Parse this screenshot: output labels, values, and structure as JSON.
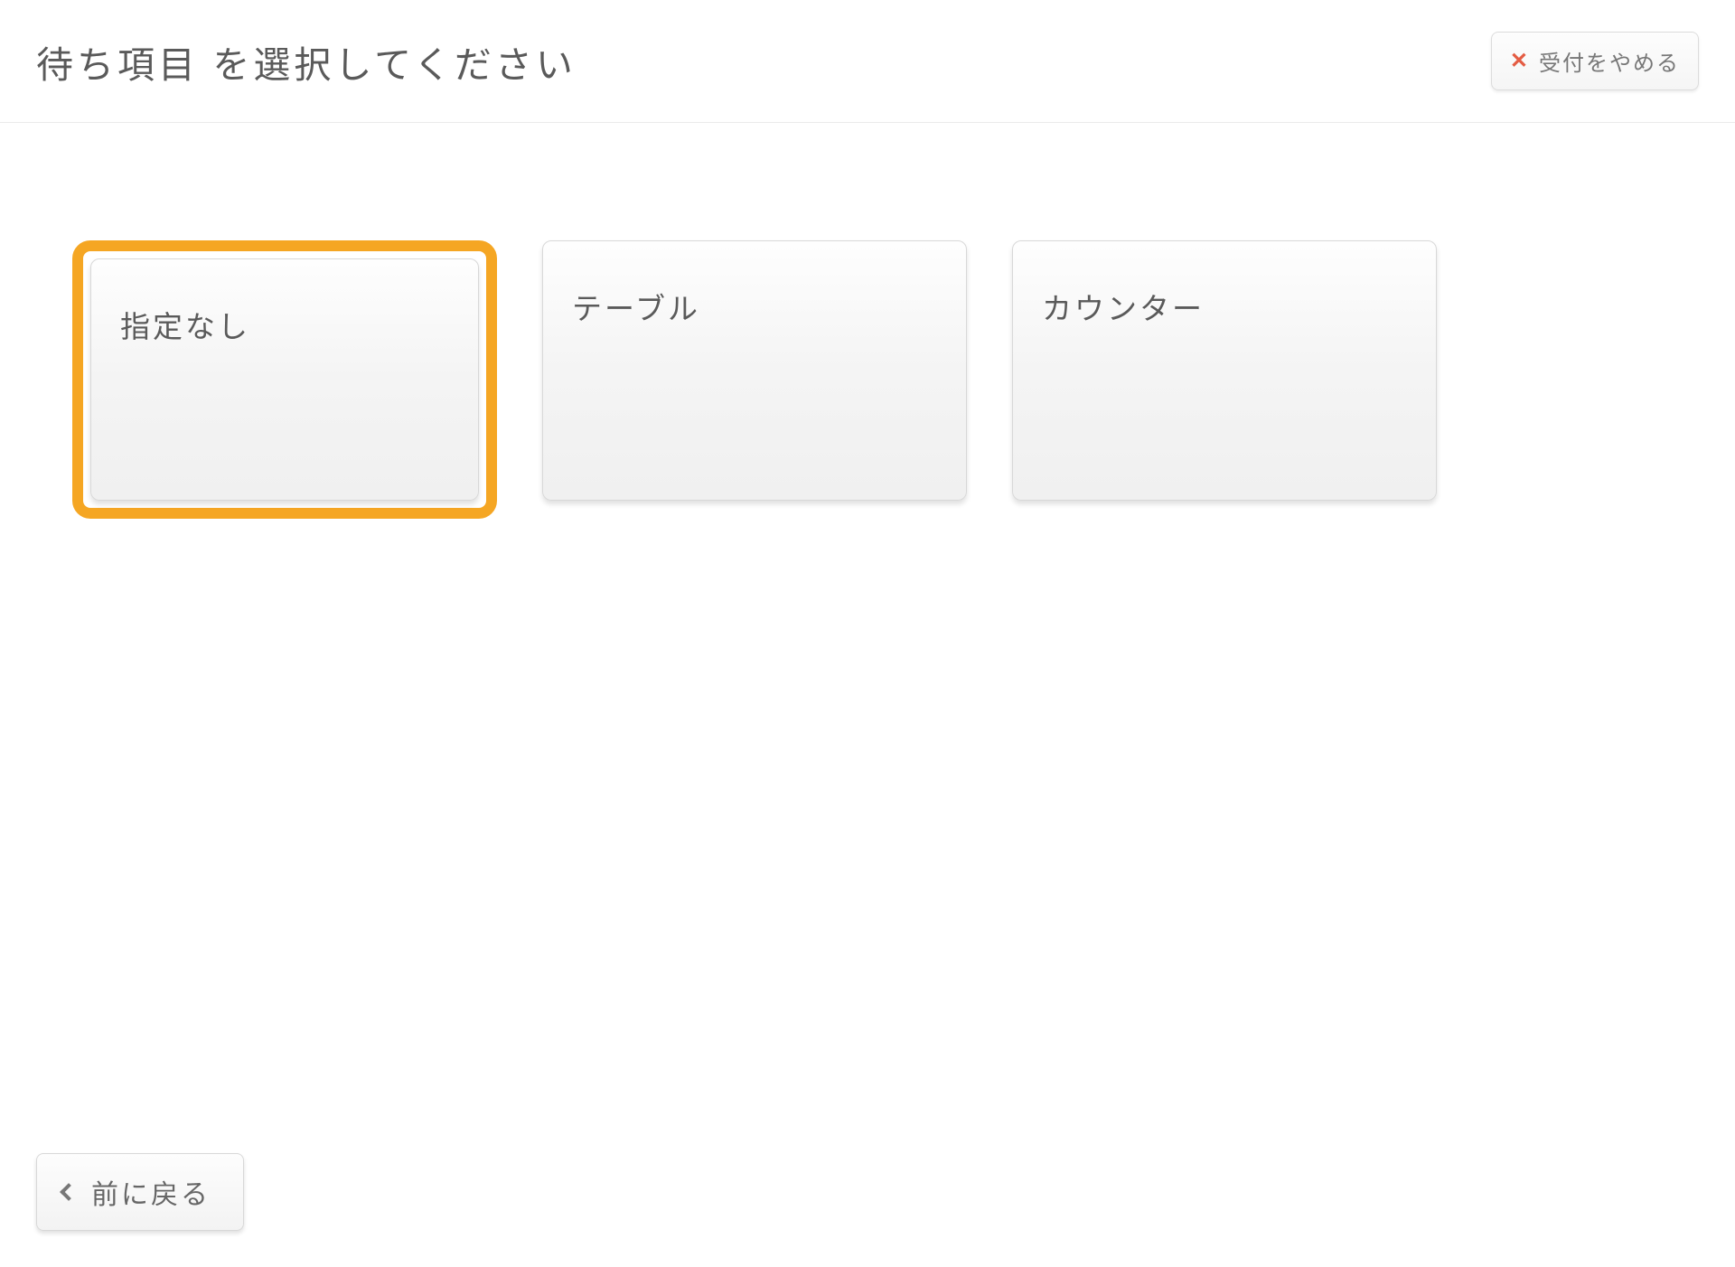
{
  "header": {
    "title": "待ち項目 を選択してください",
    "cancel_label": "受付をやめる"
  },
  "options": [
    {
      "label": "指定なし",
      "selected": true
    },
    {
      "label": "テーブル",
      "selected": false
    },
    {
      "label": "カウンター",
      "selected": false
    }
  ],
  "footer": {
    "back_label": "前に戻る"
  },
  "colors": {
    "accent": "#f5a623",
    "close_icon": "#e45c43"
  }
}
